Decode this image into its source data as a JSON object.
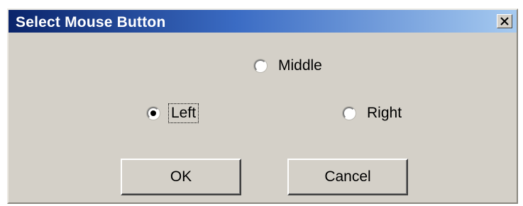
{
  "dialog": {
    "title": "Select Mouse Button",
    "close_icon": "close-x-icon"
  },
  "options": {
    "middle": {
      "label": "Middle",
      "selected": false
    },
    "left": {
      "label": "Left",
      "selected": true
    },
    "right": {
      "label": "Right",
      "selected": false
    }
  },
  "buttons": {
    "ok_label": "OK",
    "cancel_label": "Cancel"
  }
}
